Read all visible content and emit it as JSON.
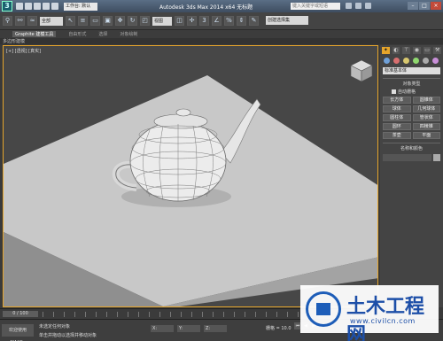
{
  "title_bar": {
    "logo": "3",
    "workspace": "工作台: 默认",
    "app_title": "Autodesk 3ds Max 2014 x64    无标题",
    "search_placeholder": "键入关键字或短语"
  },
  "toolbar": {
    "selection_filter": "全部",
    "view_dropdown": "视图",
    "named_selection": "创建选择集"
  },
  "ribbon": {
    "tabs": [
      "Graphite 建模工具",
      "自由形式",
      "选择",
      "对象绘制"
    ],
    "sub_label": "多边形建模"
  },
  "viewport": {
    "label": "[+] [透视] [真实]",
    "accent": "#e6a52b"
  },
  "command_panel": {
    "dropdown": "标准基本体",
    "object_type_header": "对象类型",
    "autogrid": "自动栅格",
    "buttons": [
      "长方体",
      "圆锥体",
      "球体",
      "几何球体",
      "圆柱体",
      "管状体",
      "圆环",
      "四棱锥",
      "茶壶",
      "平面"
    ],
    "name_color_header": "名称和颜色"
  },
  "timeline": {
    "slider": "0 / 100"
  },
  "status": {
    "left_label": "欢迎使用 MAXSc",
    "msg1": "未选定任何对象",
    "msg2": "单击并拖动以选择并移动对象",
    "x_label": "X:",
    "y_label": "Y:",
    "z_label": "Z:",
    "grid": "栅格 = 10.0"
  },
  "watermark": {
    "title": "土木工程网",
    "url": "www.civilcn.com"
  }
}
